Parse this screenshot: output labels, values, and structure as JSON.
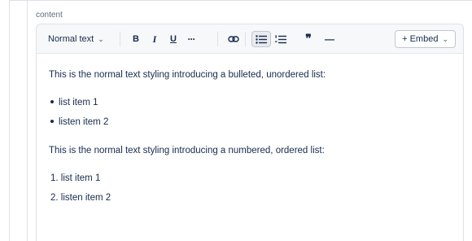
{
  "field": {
    "label": "content"
  },
  "toolbar": {
    "text_style": "Normal text",
    "bold": "B",
    "italic": "I",
    "underline": "U",
    "more": "···",
    "link_icon": "link-icon",
    "quote": "❞",
    "divider": "—",
    "embed_label": "+ Embed"
  },
  "content": {
    "para1": "This is the normal text styling introducing a bulleted, unordered list:",
    "bullets": [
      "list item 1",
      "listen item 2"
    ],
    "para2": "This is the normal text styling introducing a numbered, ordered list:",
    "numbered": [
      "1. list item 1",
      "2. listen item 2"
    ]
  }
}
